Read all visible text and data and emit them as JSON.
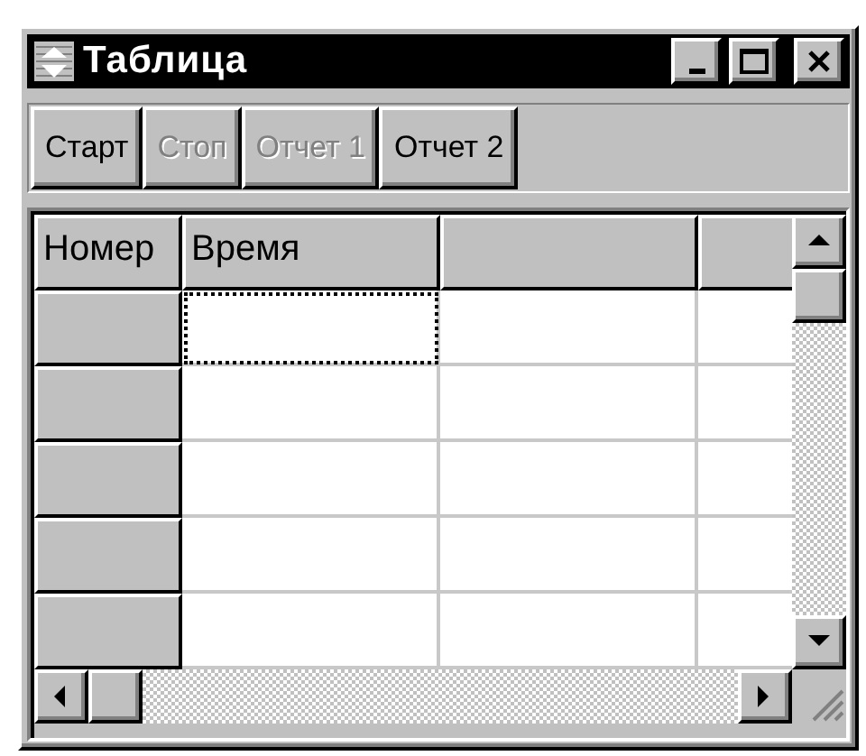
{
  "window": {
    "title": "Таблица"
  },
  "toolbar": {
    "buttons": [
      {
        "label": "Старт",
        "disabled": false
      },
      {
        "label": "Стоп",
        "disabled": true
      },
      {
        "label": "Отчет 1",
        "disabled": true
      },
      {
        "label": "Отчет 2",
        "disabled": false
      }
    ]
  },
  "grid": {
    "columns": [
      "Номер",
      "Время"
    ],
    "rows": [
      {
        "focused": true
      },
      {
        "focused": false
      },
      {
        "focused": false
      },
      {
        "focused": false
      },
      {
        "focused": false
      }
    ]
  }
}
